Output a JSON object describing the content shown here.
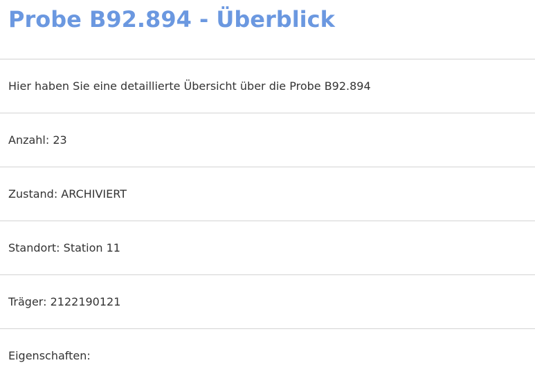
{
  "page": {
    "title": "Probe B92.894 - Überblick",
    "description": "Hier haben Sie eine detaillierte Übersicht über die Probe B92.894"
  },
  "details": [
    {
      "label": "Anzahl:",
      "value": "23"
    },
    {
      "label": "Zustand:",
      "value": "ARCHIVIERT"
    },
    {
      "label": "Standort:",
      "value": "Station 11"
    },
    {
      "label": "Träger:",
      "value": "2122190121"
    },
    {
      "label": "Eigenschaften:",
      "value": ""
    }
  ],
  "colors": {
    "title": "#6b98e0",
    "text": "#333333",
    "divider": "#d3d3d3"
  }
}
